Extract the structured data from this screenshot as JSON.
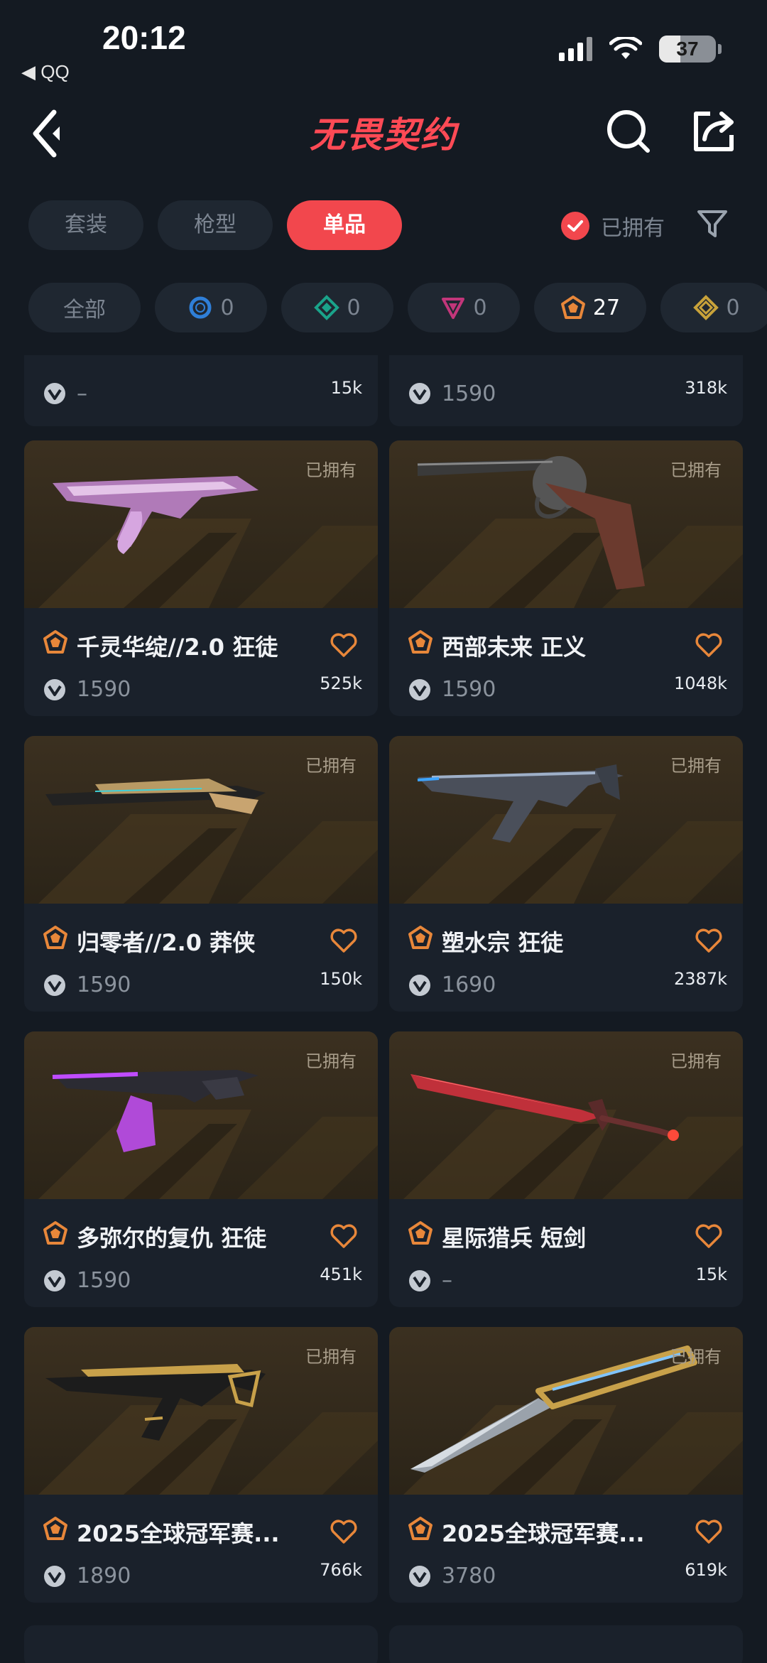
{
  "status_bar": {
    "time": "20:12",
    "back_app": "◀ QQ",
    "battery": "37",
    "battery_level": 0.37
  },
  "nav": {
    "title": "无畏契约"
  },
  "tabs": [
    {
      "label": "套装",
      "active": false
    },
    {
      "label": "枪型",
      "active": false
    },
    {
      "label": "单品",
      "active": true
    }
  ],
  "owned_filter": {
    "label": "已拥有",
    "checked": true
  },
  "rarity_chips": [
    {
      "label": "全部",
      "icon": "all"
    },
    {
      "label": "0",
      "icon": "select-tier-icon",
      "color": "#2f7fd8"
    },
    {
      "label": "0",
      "icon": "deluxe-tier-icon",
      "color": "#1aa38a"
    },
    {
      "label": "0",
      "icon": "premium-tier-icon",
      "color": "#c2367a"
    },
    {
      "label": "27",
      "icon": "exclusive-tier-icon",
      "color": "#e8873a",
      "selected": true
    },
    {
      "label": "0",
      "icon": "ultra-tier-icon",
      "color": "#c8a23a"
    }
  ],
  "partial_cards": [
    {
      "price": "–",
      "likes": "15k"
    },
    {
      "price": "1590",
      "likes": "318k"
    }
  ],
  "cards": [
    {
      "name": "千灵华绽//2.0 狂徒",
      "price": "1590",
      "likes": "525k",
      "owned": "已拥有",
      "weapon": "vandal-pink"
    },
    {
      "name": "西部未来 正义",
      "price": "1590",
      "likes": "1048k",
      "owned": "已拥有",
      "weapon": "revolver"
    },
    {
      "name": "归零者//2.0 莽侠",
      "price": "1590",
      "likes": "150k",
      "owned": "已拥有",
      "weapon": "sniper-gold"
    },
    {
      "name": "塑水宗 狂徒",
      "price": "1690",
      "likes": "2387k",
      "owned": "已拥有",
      "weapon": "vandal-chrome"
    },
    {
      "name": "多弥尔的复仇 狂徒",
      "price": "1590",
      "likes": "451k",
      "owned": "已拥有",
      "weapon": "vandal-crystal"
    },
    {
      "name": "星际猎兵 短剑",
      "price": "–",
      "likes": "15k",
      "owned": "已拥有",
      "weapon": "sword-red"
    },
    {
      "name": "2025全球冠军赛...",
      "price": "1890",
      "likes": "766k",
      "owned": "已拥有",
      "weapon": "vandal-champ"
    },
    {
      "name": "2025全球冠军赛...",
      "price": "3780",
      "likes": "619k",
      "owned": "已拥有",
      "weapon": "knife-champ"
    }
  ],
  "colors": {
    "accent": "#f2474d",
    "tier_exclusive": "#e8873a",
    "heart": "#e8873a"
  }
}
